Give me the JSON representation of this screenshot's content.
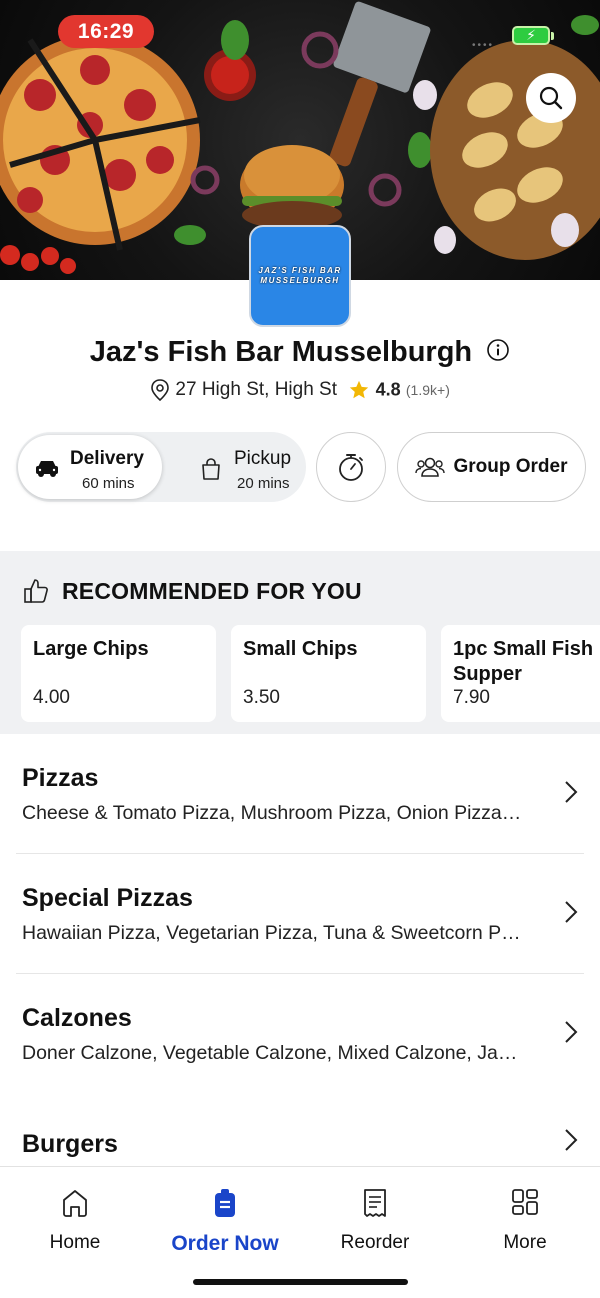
{
  "status_bar": {
    "time": "16:29",
    "battery_glyph": "⚡",
    "battery_color": "#2ecc40"
  },
  "restaurant": {
    "name": "Jaz's Fish Bar Musselburgh",
    "logo_line1": "JAZ'S FISH BAR",
    "logo_line2": "MUSSELBURGH",
    "address": "27 High St, High St",
    "rating": "4.8",
    "reviews": "(1.9k+)"
  },
  "order_modes": {
    "delivery": {
      "label": "Delivery",
      "time": "60 mins",
      "selected": true
    },
    "pickup": {
      "label": "Pickup",
      "time": "20 mins",
      "selected": false
    }
  },
  "group_order_label": "Group Order",
  "recommended": {
    "heading": "RECOMMENDED FOR YOU",
    "items": [
      {
        "name": "Large Chips",
        "price": "4.00"
      },
      {
        "name": "Small Chips",
        "price": "3.50"
      },
      {
        "name": "1pc Small Fish Supper",
        "price": "7.90"
      }
    ]
  },
  "categories": [
    {
      "title": "Pizzas",
      "desc": "Cheese & Tomato Pizza, Mushroom Pizza, Onion Pizza…"
    },
    {
      "title": "Special Pizzas",
      "desc": "Hawaiian Pizza, Vegetarian Pizza, Tuna & Sweetcorn P…"
    },
    {
      "title": "Calzones",
      "desc": "Doner Calzone, Vegetable Calzone, Mixed Calzone, Ja…"
    },
    {
      "title": "Burgers",
      "desc": ""
    }
  ],
  "bottom_nav": [
    {
      "label": "Home",
      "icon": "home-icon",
      "active": false
    },
    {
      "label": "Order Now",
      "icon": "order-bag-icon",
      "active": true
    },
    {
      "label": "Reorder",
      "icon": "receipt-icon",
      "active": false
    },
    {
      "label": "More",
      "icon": "grid-icon",
      "active": false
    }
  ],
  "colors": {
    "accent": "#1a45c9",
    "time_pill": "#e2372f",
    "star": "#f2b705",
    "logo_bg": "#2a86e6"
  }
}
